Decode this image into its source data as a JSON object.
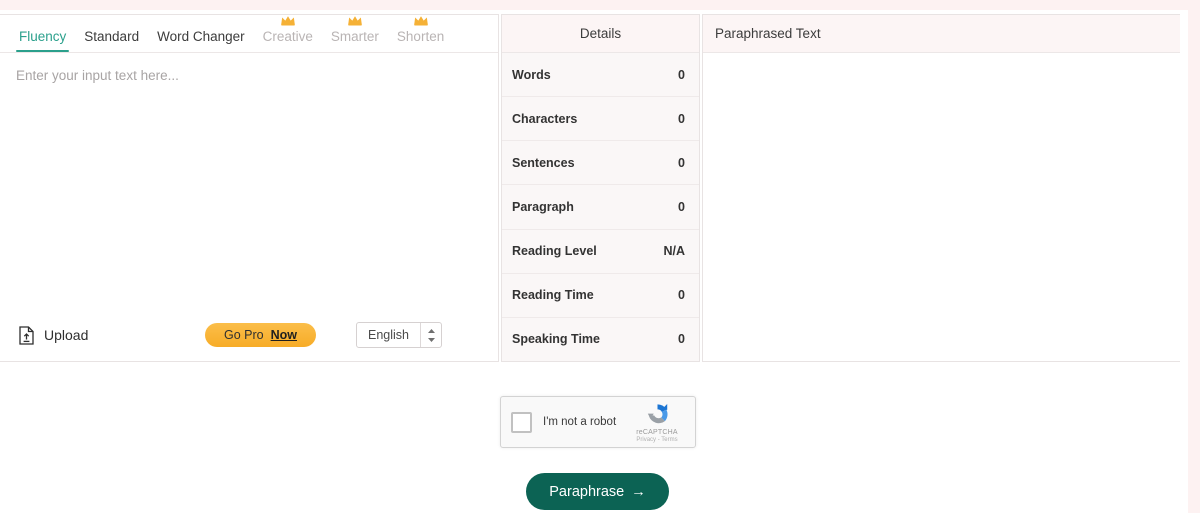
{
  "theme": {
    "accent_teal": "#2ba08c",
    "button_green": "#0c6354",
    "pro_orange": "#f7ac27",
    "panel_header_bg": "#fcf5f5",
    "page_tint": "#fdf2f2"
  },
  "tabs": [
    {
      "label": "Fluency",
      "active": true,
      "pro": false
    },
    {
      "label": "Standard",
      "active": false,
      "pro": false
    },
    {
      "label": "Word Changer",
      "active": false,
      "pro": false
    },
    {
      "label": "Creative",
      "active": false,
      "pro": true
    },
    {
      "label": "Smarter",
      "active": false,
      "pro": true
    },
    {
      "label": "Shorten",
      "active": false,
      "pro": true
    }
  ],
  "editor": {
    "placeholder": "Enter your input text here...",
    "value": "",
    "upload_label": "Upload",
    "gopro": {
      "prefix": "Go Pro",
      "emphasis": "Now"
    },
    "language": {
      "selected": "English"
    }
  },
  "details": {
    "title": "Details",
    "rows": [
      {
        "label": "Words",
        "value": "0"
      },
      {
        "label": "Characters",
        "value": "0"
      },
      {
        "label": "Sentences",
        "value": "0"
      },
      {
        "label": "Paragraph",
        "value": "0"
      },
      {
        "label": "Reading Level",
        "value": "N/A"
      },
      {
        "label": "Reading Time",
        "value": "0"
      },
      {
        "label": "Speaking Time",
        "value": "0"
      }
    ]
  },
  "output": {
    "title": "Paraphrased Text",
    "value": ""
  },
  "captcha": {
    "checkbox_label": "I'm not a robot",
    "brand": "reCAPTCHA",
    "legal": "Privacy - Terms",
    "checked": false
  },
  "actions": {
    "paraphrase_label": "Paraphrase",
    "paraphrase_arrow": "→"
  }
}
